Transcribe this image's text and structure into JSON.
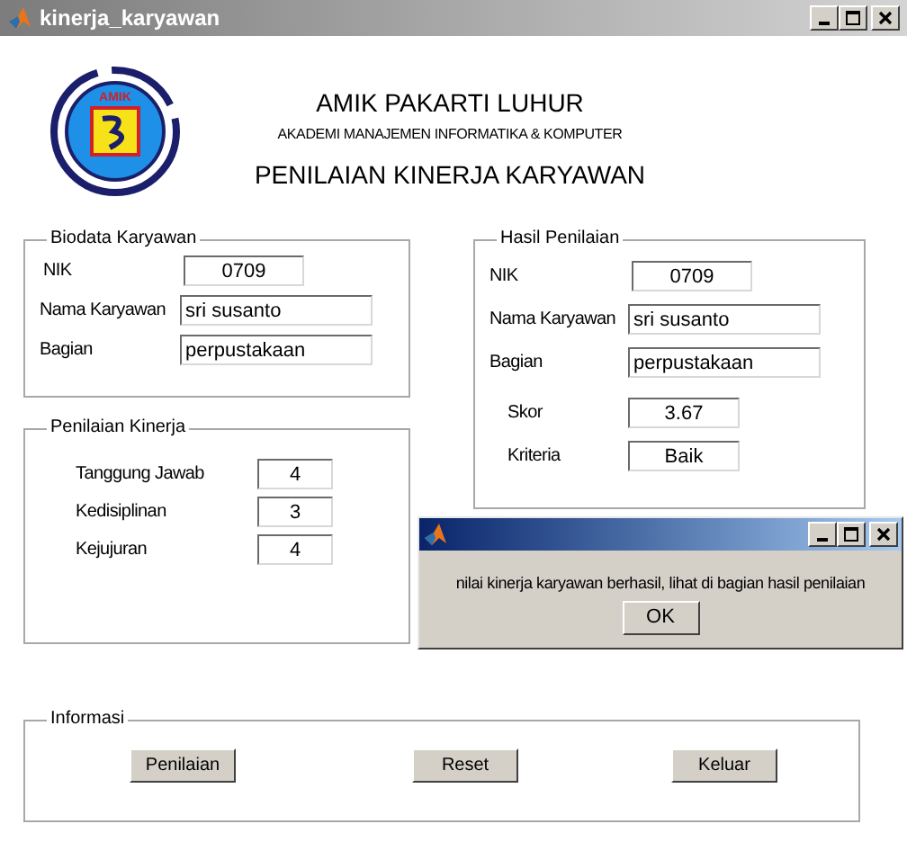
{
  "window": {
    "title": "kinerja_karyawan"
  },
  "header": {
    "logo_text": "AMIK",
    "title": "AMIK PAKARTI LUHUR",
    "subtitle": "AKADEMI MANAJEMEN INFORMATIKA & KOMPUTER",
    "heading": "PENILAIAN KINERJA KARYAWAN"
  },
  "biodata": {
    "title": "Biodata Karyawan",
    "fields": [
      {
        "label": "NIK",
        "value": "0709",
        "kind": "number"
      },
      {
        "label": "Nama Karyawan",
        "value": "sri susanto",
        "kind": "text"
      },
      {
        "label": "Bagian",
        "value": "perpustakaan",
        "kind": "text"
      }
    ]
  },
  "penilaian": {
    "title": "Penilaian Kinerja",
    "fields": [
      {
        "label": "Tanggung Jawab",
        "value": "4"
      },
      {
        "label": "Kedisiplinan",
        "value": "3"
      },
      {
        "label": "Kejujuran",
        "value": "4"
      }
    ]
  },
  "hasil": {
    "title": "Hasil Penilaian",
    "fields": [
      {
        "label": "NIK",
        "value": "0709",
        "kind": "number"
      },
      {
        "label": "Nama Karyawan",
        "value": "sri susanto",
        "kind": "text"
      },
      {
        "label": "Bagian",
        "value": "perpustakaan",
        "kind": "text"
      },
      {
        "label": "Skor",
        "value": "3.67",
        "kind": "score"
      },
      {
        "label": "Kriteria",
        "value": "Baik",
        "kind": "score"
      }
    ]
  },
  "informasi": {
    "title": "Informasi",
    "buttons": [
      "Penilaian",
      "Reset",
      "Keluar"
    ]
  },
  "dialog": {
    "message": "nilai kinerja karyawan berhasil, lihat di bagian hasil penilaian",
    "button": "OK"
  }
}
